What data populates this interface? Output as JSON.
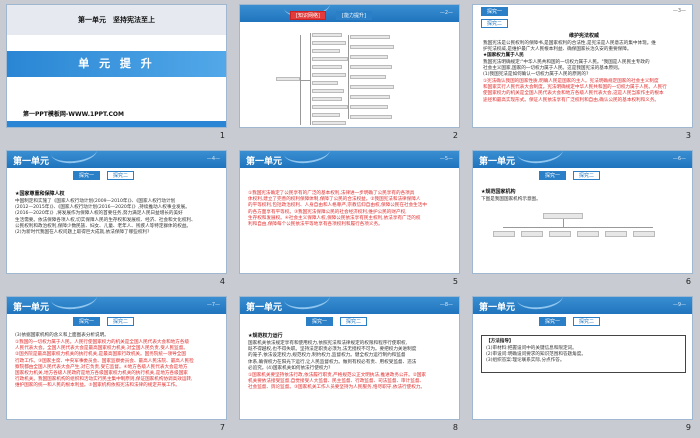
{
  "slides": [
    {
      "num": "1",
      "unit_title": "第一单元　坚持宪法至上",
      "banner": "单 元 提 升",
      "footer": "第一PPT模板网-WWW.1PPT.COM"
    },
    {
      "num": "2",
      "header": "第一单元",
      "page_tag": "—2—",
      "tags": [
        "[知识网络]",
        "[能力提升]"
      ]
    },
    {
      "num": "3",
      "page_tag": "—3—",
      "tags": [
        "探究一",
        "探究二"
      ],
      "heading_red": "[知识网络]",
      "title": "维护宪法权威",
      "lines": [
        "我国宪法是公民权利的保障书,是国家权利的合法性,是宪法是人民意志的集中体现。维",
        "护宪法权威,是维护最广大人民根本利益、确保国家长治久安的重要保障。",
        "★国家权力属于人民",
        "我国宪法明确规定:\"中华人民共和国的一切权力属于人民。\"我国是人民民主专政的",
        "社会主义国家,国家的一切权力属于人民。这是我国宪法的基本原则。",
        "(1)我国宪法是如何确认一切权力属于人民的原则的?"
      ],
      "red_lines": [
        "①宪法确认我国的国家性质,明确人民是国家的主人。宪法明确规定国家的社会主义制度",
        "和国家实行人民代表大会制度。宪法明确规定中华人民共和国的一切权力属于人民。人民行",
        "使国家权力的机关是全国人民代表大会和地方各级人民代表大会,这是人民当家作主的根本",
        "途径和最高实现形式。保证人民依法享有广泛权利和自由,确认公民的基本权利和义务。"
      ]
    },
    {
      "num": "4",
      "header": "第一单元",
      "page_tag": "—4—",
      "tags": [
        "探究一",
        "探究二"
      ],
      "heading": "★国家尊重和保障人权",
      "lines": [
        "中国制定和实施了《国家人权行动计划(2009—2010年)》、《国家人权行动计划",
        "(2012—2015年)》、《国家人权行动计划(2016—2020年)》,持续推动人权事业发展。",
        "(2016—2020年)》,将发展作为保障人权的首要任务,努力满足人民日益增长的美好",
        "生活需要。依法保障各项人权,切实保障人民的生存权和发展权、经济、社会和文化权利、",
        "公民权利和政治权利,保障少数民族、妇女、儿童、老年人、残疾人等特定群体的权益。",
        "(2)为新时代我国在人权问题上取得巨大成就,依法保障了哪些权利?"
      ]
    },
    {
      "num": "5",
      "header": "第一单元",
      "page_tag": "—5—",
      "red_lines": [
        "①我国宪法确定了公民享有的广泛的基本权利,法律进一步明确了公民享有的各项具",
        "体权利,建立了完善的权利保障体制,保障了公民的合法权益。②我国宪法和法律保障人",
        "的平等权利,包括政治权利、人身自由和人格尊严,宗教信仰自由权,保障公民在社会生活中",
        "的各方面享有平等权。③我国宪法保障公民的社会经济权利,维护公民的财产权,",
        "生存权和发展权。④社会主义保障人权,保障公民依法享有民主权利,依法享有广泛的权",
        "利和自由,保障每个公民依法平等地享有各项权利和履行各项义务。"
      ]
    },
    {
      "num": "6",
      "header": "第一单元",
      "page_tag": "—6—",
      "tags": [
        "探究一",
        "探究二"
      ],
      "heading": "★规范国家机构",
      "sub": "下图是我国国家机构示意图。"
    },
    {
      "num": "7",
      "header": "第一单元",
      "page_tag": "—7—",
      "tags": [
        "探究一",
        "探究二"
      ],
      "lines": [
        "(3)依据国家机构的含义和上面图表分析说明。"
      ],
      "red_lines": [
        "①我国的一切权力属于人民。人民行使国家权力的机关是全国人民代表大会和地方各级",
        "人民代表大会。全国人民代表大会是最高国家权力机关,对全国人民负责,受人民监督。",
        "②国务院是最高国家权力机关的执行机关,是最高国家行政机关。国务院统一领导全国",
        "行政工作。③国家主席、中央军事委员会、国家监察委员会、最高人民法院、最高人民检",
        "察院都由全国人民代表大会产生,对它负责,受它监督。④地方各级人民代表大会是地方",
        "国家权力机关,地方各级人民政府是地方各级国家权力机关的执行机关,是地方各级国家",
        "行政机关。我国国家机构的组织和活动实行民主集中制原则,保证国家机构协调高效运转,",
        "维护国家的统一和人民的根本利益。⑤国家机构依照宪法和法律的规定开展工作。"
      ]
    },
    {
      "num": "8",
      "header": "第一单元",
      "page_tag": "—8—",
      "tags": [
        "探究一",
        "探究二"
      ],
      "heading": "★规范权力运行",
      "lines": [
        "国家机关依法规定享有和使用权力,依照宪法和法律规定的权限和程序行使职权,",
        "既不得越权,也不得失职。坚持法定职责必须为,法无授权不可为。要把权力关进制度",
        "的笼子,依法设定权力,规范权力,制约权力,监督权力。健全权力运行制约和监督",
        "体系,确保权力在阳光下运行,让人民监督权力。做到有权必有责、用权受监督、违法",
        "必追究。(4)国家机关如何依法行使权力?"
      ],
      "red_lines": [
        "①国家机关要坚持依法行政,依法履行职责,严格规范公正文明执法,推进政务公开。②国家",
        "机关要依法接受监督,自觉接受人大监督、民主监督、行政监督、司法监督、审计监督、",
        "社会监督、舆论监督。③国家机关工作人员要坚持为人民服务,恪尽职守,依法行使权力。"
      ]
    },
    {
      "num": "9",
      "header": "第一单元",
      "page_tag": "—9—",
      "tags": [
        "探究一",
        "探究二"
      ],
      "box_title": "【方法指导】",
      "box_lines": [
        "(1)审材料:把握设问中的关键信息和限定词。",
        "(2)审设问:明确设问要求的知识范围和答题角度。",
        "(3)组织答案:理论联系实际,分点作答。"
      ]
    }
  ]
}
